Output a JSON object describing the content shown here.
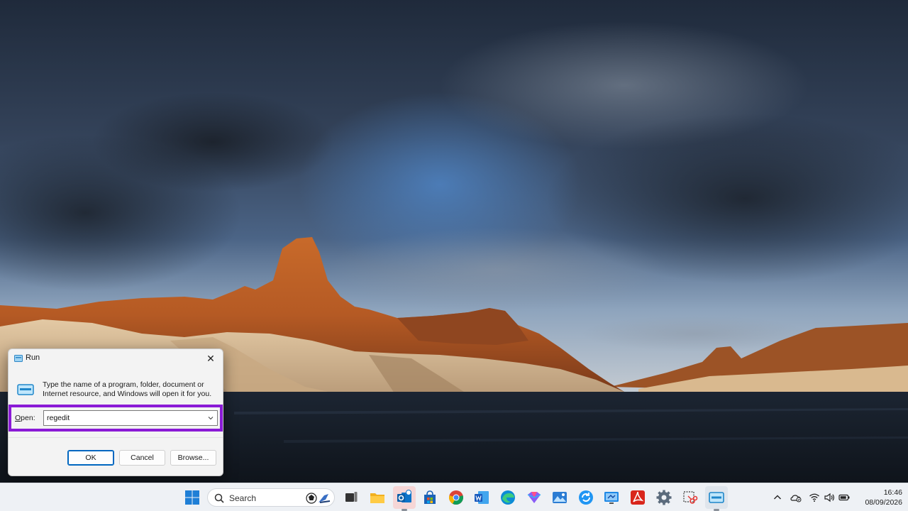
{
  "colors": {
    "highlight_border": "#8a1ad6",
    "accent": "#0067c0"
  },
  "run_dialog": {
    "title": "Run",
    "description": "Type the name of a program, folder, document or Internet resource, and Windows will open it for you.",
    "open_label_prefix": "O",
    "open_label_rest": "pen:",
    "open_value": "regedit",
    "ok_label": "OK",
    "cancel_label": "Cancel",
    "browse_label": "Browse..."
  },
  "taskbar": {
    "search_placeholder": "Search",
    "icons": [
      "start-icon",
      "search-icon",
      "task-view-icon",
      "file-explorer-icon",
      "outlook-icon",
      "store-icon",
      "chrome-icon",
      "word-icon",
      "edge-icon",
      "copilot-icon",
      "photo-editor-icon",
      "sync-icon",
      "remote-desktop-icon",
      "acrobat-icon",
      "settings-icon",
      "snipping-tool-icon",
      "run-icon"
    ]
  },
  "tray": {
    "icons": [
      "chevron-up-icon",
      "onedrive-icon",
      "wifi-icon",
      "volume-icon",
      "battery-icon"
    ],
    "time": "16:46",
    "date": "08/09/2026"
  }
}
